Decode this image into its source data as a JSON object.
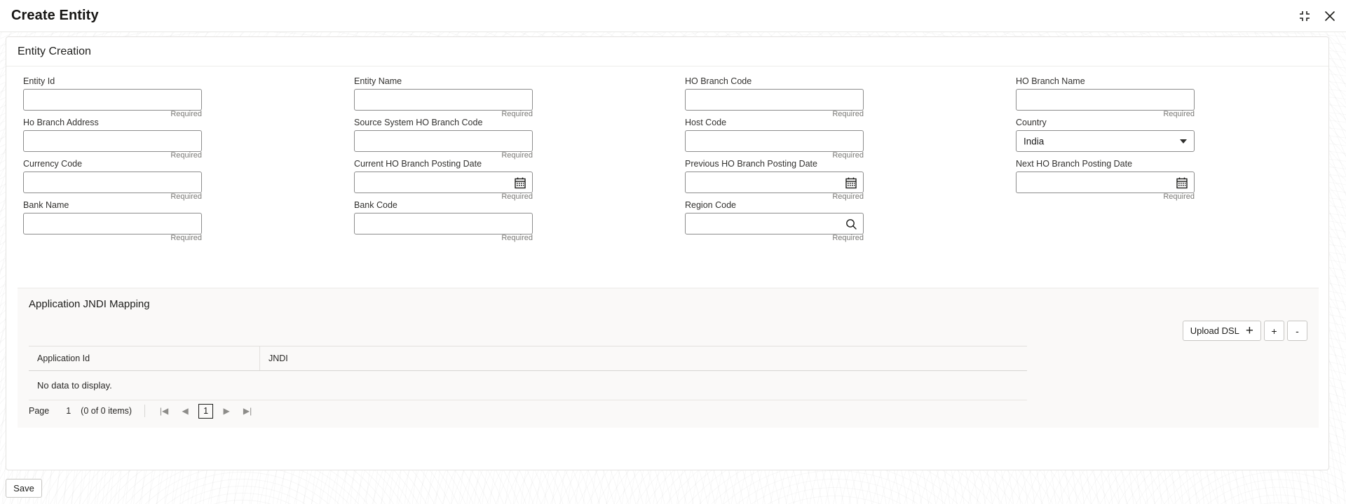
{
  "window": {
    "title": "Create Entity",
    "minimize_icon": "collapse-corners-icon",
    "close_icon": "close-x-icon"
  },
  "card": {
    "section_title": "Entity Creation"
  },
  "form": {
    "required_text": "Required",
    "fields": [
      {
        "label": "Entity Id",
        "value": "",
        "required": "Required",
        "icon": "none",
        "type": "text"
      },
      {
        "label": "Entity Name",
        "value": "",
        "required": "Required",
        "icon": "none",
        "type": "text"
      },
      {
        "label": "HO Branch Code",
        "value": "",
        "required": "Required",
        "icon": "none",
        "type": "text"
      },
      {
        "label": "HO Branch Name",
        "value": "",
        "required": "Required",
        "icon": "none",
        "type": "text"
      },
      {
        "label": "Ho Branch Address",
        "value": "",
        "required": "Required",
        "icon": "none",
        "type": "text"
      },
      {
        "label": "Source System HO Branch Code",
        "value": "",
        "required": "Required",
        "icon": "none",
        "type": "text"
      },
      {
        "label": "Host Code",
        "value": "",
        "required": "Required",
        "icon": "none",
        "type": "text"
      },
      {
        "label": "Country",
        "value": "India",
        "required": "",
        "icon": "chevron-down-icon",
        "type": "select"
      },
      {
        "label": "Currency Code",
        "value": "",
        "required": "Required",
        "icon": "none",
        "type": "text"
      },
      {
        "label": "Current HO Branch Posting Date",
        "value": "",
        "required": "Required",
        "icon": "calendar-icon",
        "type": "date"
      },
      {
        "label": "Previous HO Branch Posting Date",
        "value": "",
        "required": "Required",
        "icon": "calendar-icon",
        "type": "date"
      },
      {
        "label": "Next HO Branch Posting Date",
        "value": "",
        "required": "Required",
        "icon": "calendar-icon",
        "type": "date"
      },
      {
        "label": "Bank Name",
        "value": "",
        "required": "Required",
        "icon": "none",
        "type": "text"
      },
      {
        "label": "Bank Code",
        "value": "",
        "required": "Required",
        "icon": "none",
        "type": "text"
      },
      {
        "label": "Region Code",
        "value": "",
        "required": "Required",
        "icon": "search-icon",
        "type": "lov"
      }
    ],
    "country_selected": "India"
  },
  "jndi": {
    "title": "Application JNDI Mapping",
    "upload_label": "Upload DSL",
    "upload_plus": "+",
    "add_label": "+",
    "remove_label": "-",
    "columns": [
      "Application Id",
      "JNDI"
    ],
    "rows": [],
    "empty_text": "No data to display."
  },
  "pagination": {
    "page_label": "Page",
    "page_number": "1",
    "items_text": "(0 of 0 items)",
    "first": "|◀",
    "prev": "◀",
    "current": "1",
    "next": "▶",
    "last": "▶|"
  },
  "footer": {
    "save_label": "Save"
  },
  "colors": {
    "text": "#161513",
    "muted": "#7a7976",
    "border": "#8c8c8c",
    "panel": "#faf9f8"
  }
}
